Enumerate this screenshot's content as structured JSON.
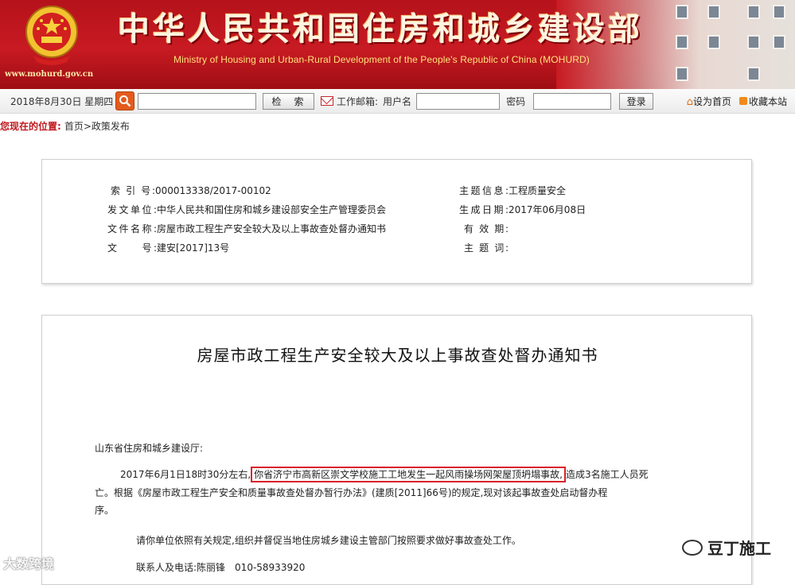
{
  "header": {
    "site_url": "www.mohurd.gov.cn",
    "title_cn": "中华人民共和国住房和城乡建设部",
    "title_en": "Ministry of Housing and Urban-Rural Development of the People's Republic of China (MOHURD)",
    "colors": {
      "banner": "#c81a22",
      "title_text": "#fff4e0",
      "subtitle_text": "#ffe27a"
    }
  },
  "toolbar": {
    "date": "2018年8月30日 星期四",
    "search_value": "",
    "search_button": "检　索",
    "mail_label": "工作邮箱:",
    "username_label": "用户名",
    "username_value": "",
    "password_label": "密码",
    "password_value": "",
    "login_button": "登录",
    "set_home": "设为首页",
    "bookmark": "收藏本站"
  },
  "breadcrumb": {
    "here_label": "您现在的位置:",
    "path": "首页>政策发布"
  },
  "meta": {
    "index_no_label": "索 引 号:",
    "index_no": "000013338/2017-00102",
    "issuer_label": "发文单位:",
    "issuer": "中华人民共和国住房和城乡建设部安全生产管理委员会",
    "doc_name_label": "文件名称:",
    "doc_name": "房屋市政工程生产安全较大及以上事故查处督办通知书",
    "doc_no_label": "文　　号:",
    "doc_no": "建安[2017]13号",
    "topic_label": "主题信息:",
    "topic": "工程质量安全",
    "created_label": "生成日期:",
    "created": "2017年06月08日",
    "valid_label": "有 效 期:",
    "valid": "",
    "keywords_label": "主 题 词:",
    "keywords": ""
  },
  "article": {
    "title": "房屋市政工程生产安全较大及以上事故查处督办通知书",
    "salutation": "山东省住房和城乡建设厅:",
    "p1_before": "2017年6月1日18时30分左右,",
    "p1_highlight": "你省济宁市高新区崇文学校施工工地发生一起风雨操场网架屋顶坍塌事故,",
    "p1_after": "造成3名施工人员死",
    "p1_line2": "亡。根据《房屋市政工程生产安全和质量事故查处督办暂行办法》(建质[2011]66号)的规定,现对该起事故查处启动督办程",
    "p1_line3": "序。",
    "p2": "请你单位依照有关规定,组织并督促当地住房城乡建设主管部门按照要求做好事故查处工作。",
    "contact_label": "联系人及电话:",
    "contact": "陈丽锋　010-58933920"
  },
  "watermarks": {
    "left": "大数跨境",
    "right": "豆丁施工"
  }
}
